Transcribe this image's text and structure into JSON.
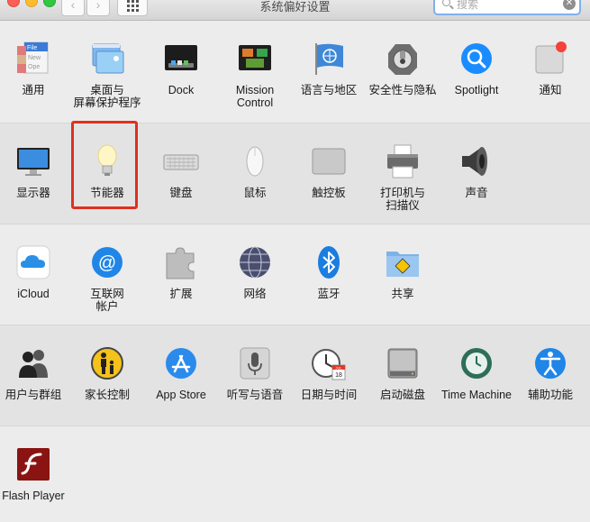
{
  "window": {
    "title": "系统偏好设置",
    "search_placeholder": "搜索",
    "search_clear": "✕",
    "back_glyph": "‹",
    "forward_glyph": "›"
  },
  "rows": [
    {
      "items": [
        {
          "name": "general",
          "label": "通用"
        },
        {
          "name": "desktop-screensaver",
          "label": "桌面与\n屏幕保护程序"
        },
        {
          "name": "dock",
          "label": "Dock"
        },
        {
          "name": "mission-control",
          "label": "Mission\nControl"
        },
        {
          "name": "language-region",
          "label": "语言与地区"
        },
        {
          "name": "security-privacy",
          "label": "安全性与隐私"
        },
        {
          "name": "spotlight",
          "label": "Spotlight"
        },
        {
          "name": "notifications",
          "label": "通知"
        }
      ]
    },
    {
      "items": [
        {
          "name": "displays",
          "label": "显示器"
        },
        {
          "name": "energy-saver",
          "label": "节能器"
        },
        {
          "name": "keyboard",
          "label": "键盘"
        },
        {
          "name": "mouse",
          "label": "鼠标"
        },
        {
          "name": "trackpad",
          "label": "触控板"
        },
        {
          "name": "printers-scanners",
          "label": "打印机与\n扫描仪"
        },
        {
          "name": "sound",
          "label": "声音"
        }
      ]
    },
    {
      "items": [
        {
          "name": "icloud",
          "label": "iCloud"
        },
        {
          "name": "internet-accounts",
          "label": "互联网\n帐户"
        },
        {
          "name": "extensions",
          "label": "扩展"
        },
        {
          "name": "network",
          "label": "网络"
        },
        {
          "name": "bluetooth",
          "label": "蓝牙"
        },
        {
          "name": "sharing",
          "label": "共享"
        }
      ]
    },
    {
      "items": [
        {
          "name": "users-groups",
          "label": "用户与群组"
        },
        {
          "name": "parental-controls",
          "label": "家长控制"
        },
        {
          "name": "app-store",
          "label": "App Store"
        },
        {
          "name": "dictation-speech",
          "label": "听写与语音"
        },
        {
          "name": "date-time",
          "label": "日期与时间"
        },
        {
          "name": "startup-disk",
          "label": "启动磁盘"
        },
        {
          "name": "time-machine",
          "label": "Time Machine"
        },
        {
          "name": "accessibility",
          "label": "辅助功能"
        }
      ]
    },
    {
      "items": [
        {
          "name": "flash-player",
          "label": "Flash Player"
        }
      ]
    }
  ],
  "icon_text": {
    "general_file": "File",
    "general_new": "New",
    "general_ope": "Ope",
    "calendar_month": "JUL",
    "calendar_day": "18"
  },
  "colors": {
    "highlight": "#e0301e",
    "accent": "#1a8cff"
  }
}
